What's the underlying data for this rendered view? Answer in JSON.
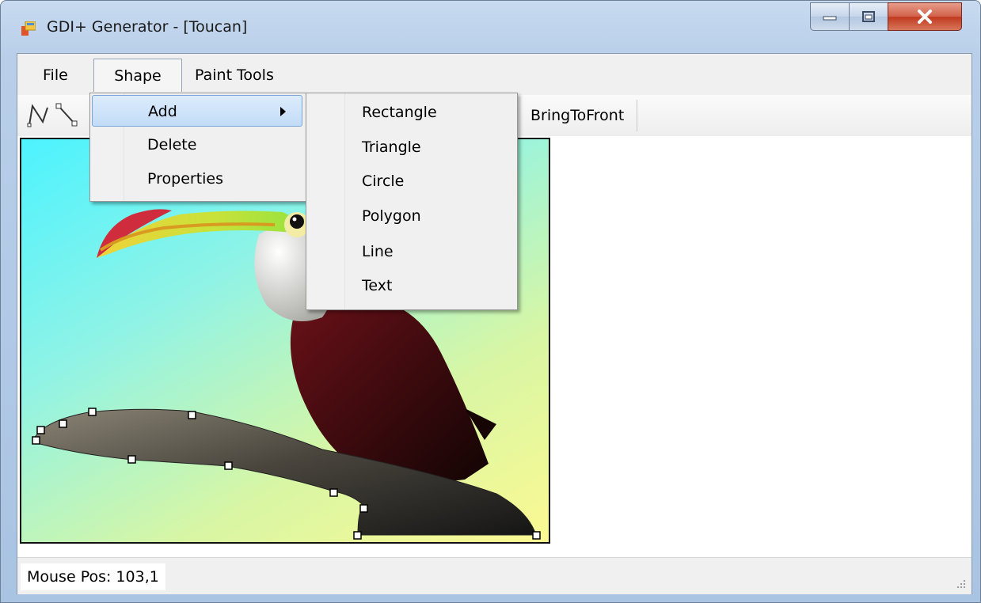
{
  "window": {
    "title": "GDI+ Generator  -  [Toucan]"
  },
  "menu": {
    "file": "File",
    "shape": "Shape",
    "paint_tools": "Paint Tools"
  },
  "toolbar": {
    "bring_to_front": "BringToFront",
    "tools": [
      "polyline-tool-icon",
      "line-tool-icon"
    ]
  },
  "shape_menu": {
    "add": "Add",
    "delete": "Delete",
    "properties": "Properties"
  },
  "add_submenu": [
    "Rectangle",
    "Triangle",
    "Circle",
    "Polygon",
    "Line",
    "Text"
  ],
  "status": {
    "mouse_pos": "Mouse Pos:  103,1"
  },
  "colors": {
    "highlight": "#c3dcf7",
    "close_button": "#c0391f",
    "canvas_border": "#111111"
  }
}
